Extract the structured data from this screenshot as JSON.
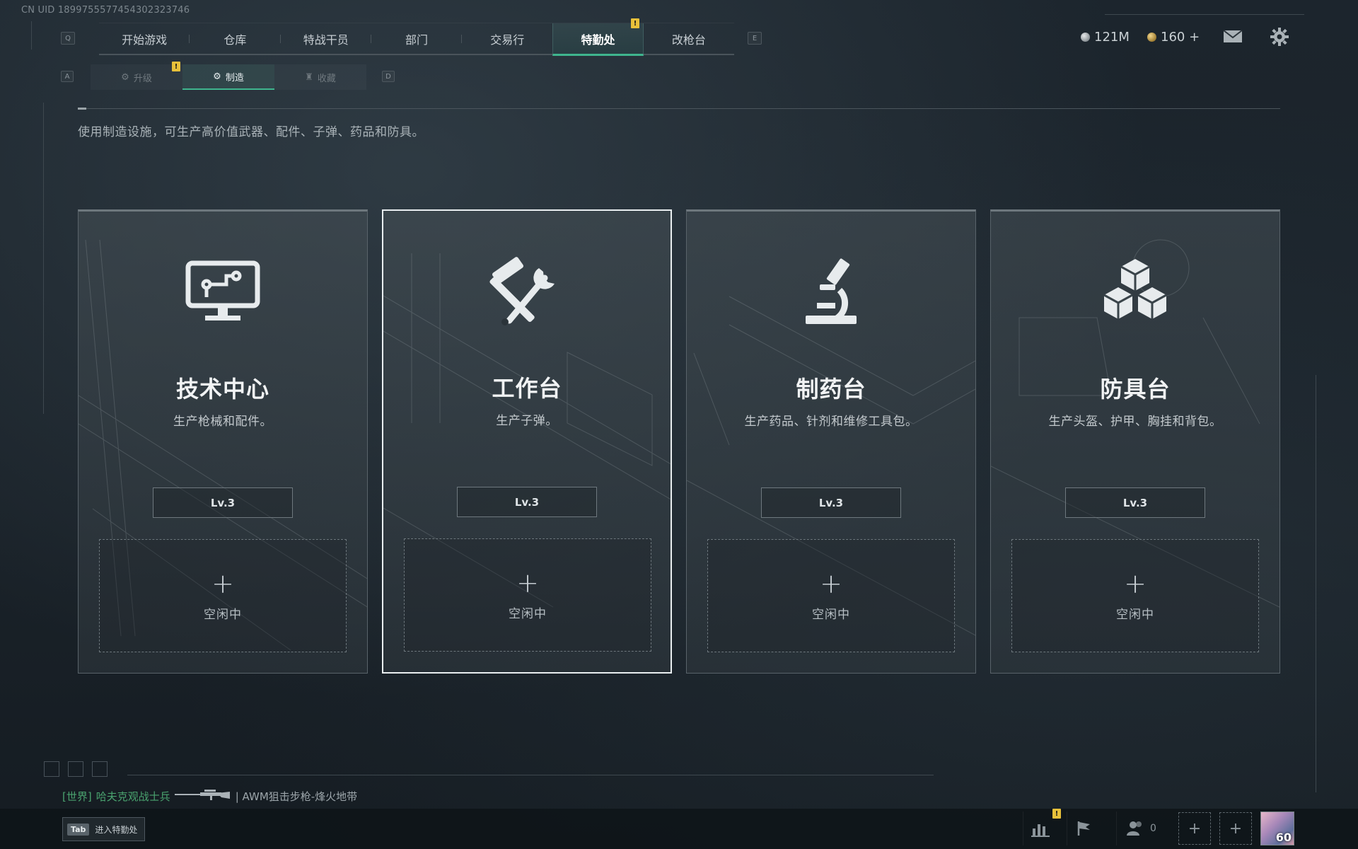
{
  "uid": "CN UID 1899755577454302323746",
  "main_nav": {
    "prev_key": "Q",
    "next_key": "E",
    "items": [
      {
        "label": "开始游戏",
        "active": false
      },
      {
        "label": "仓库",
        "active": false
      },
      {
        "label": "特战干员",
        "active": false
      },
      {
        "label": "部门",
        "active": false
      },
      {
        "label": "交易行",
        "active": false
      },
      {
        "label": "特勤处",
        "active": true
      },
      {
        "label": "改枪台",
        "active": false
      }
    ],
    "warning_badge": "!"
  },
  "resources": {
    "currency_silver": "121M",
    "currency_gold": "160 +"
  },
  "sub_nav": {
    "prev_key": "A",
    "next_key": "D",
    "items": [
      {
        "label": "升级",
        "active": false
      },
      {
        "label": "制造",
        "active": true
      },
      {
        "label": "收藏",
        "active": false
      }
    ],
    "warning_badge": "!"
  },
  "description": "使用制造设施，可生产高价值武器、配件、子弹、药品和防具。",
  "cards": [
    {
      "icon": "computer-icon",
      "title": "技术中心",
      "subtitle": "生产枪械和配件。",
      "level": "Lv.3",
      "slot_label": "空闲中",
      "selected": false
    },
    {
      "icon": "hammer-wrench-icon",
      "title": "工作台",
      "subtitle": "生产子弹。",
      "level": "Lv.3",
      "slot_label": "空闲中",
      "selected": true
    },
    {
      "icon": "microscope-icon",
      "title": "制药台",
      "subtitle": "生产药品、针剂和维修工具包。",
      "level": "Lv.3",
      "slot_label": "空闲中",
      "selected": false
    },
    {
      "icon": "boxes-icon",
      "title": "防具台",
      "subtitle": "生产头盔、护甲、胸挂和背包。",
      "level": "Lv.3",
      "slot_label": "空闲中",
      "selected": false
    }
  ],
  "chat": {
    "channel": "[世界]",
    "player": "哈夫克观战士兵",
    "item": "| AWM狙击步枪-烽火地带"
  },
  "bottom": {
    "tab_key": "Tab",
    "tab_label": "进入特勤处",
    "friends_count": "0",
    "level": "60",
    "warning_badge": "!"
  },
  "colors": {
    "accent": "#3fb58e",
    "warning": "#e8c03a",
    "chat_green": "#4aa36f"
  }
}
